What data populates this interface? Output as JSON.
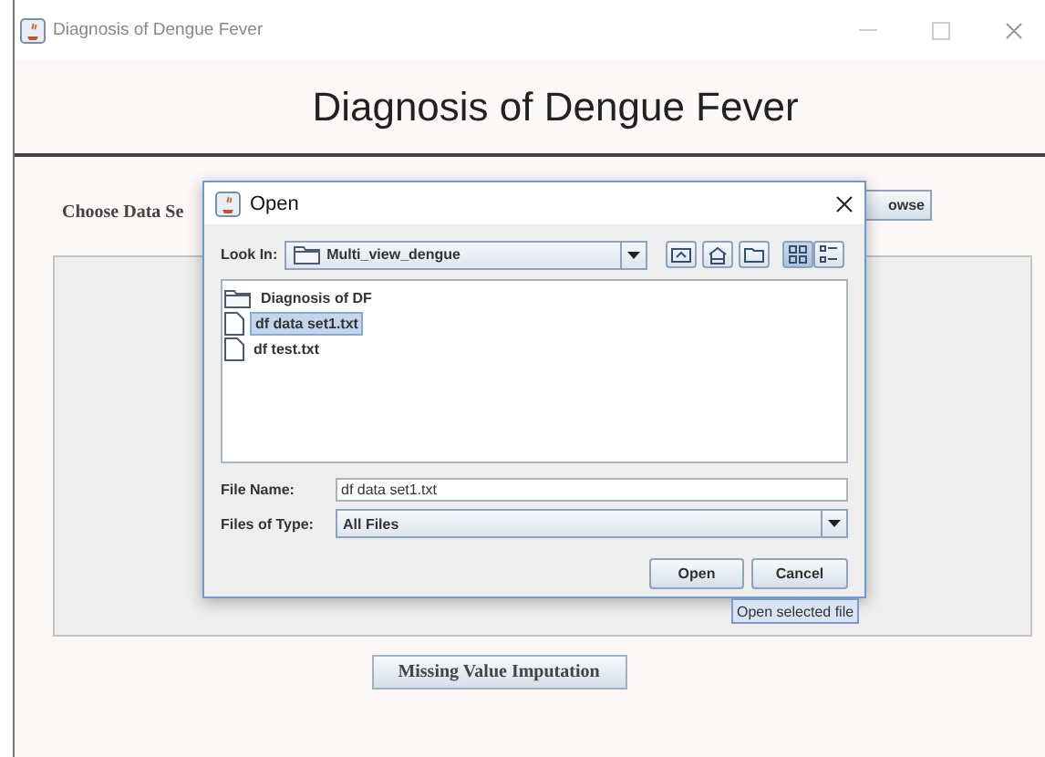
{
  "window": {
    "title": "Diagnosis of Dengue Fever"
  },
  "header": {
    "title": "Diagnosis of Dengue Fever"
  },
  "data_set": {
    "label": "Choose Data Se",
    "browse_button": "owse"
  },
  "imputation_button": "Missing Value Imputation",
  "dialog": {
    "title": "Open",
    "look_in": {
      "label": "Look In:",
      "value": "Multi_view_dengue"
    },
    "view_buttons": [
      {
        "kind": "list",
        "selected": true
      },
      {
        "kind": "details",
        "selected": false
      }
    ],
    "files": [
      {
        "name": "Diagnosis of DF",
        "kind": "folder",
        "selected": false
      },
      {
        "name": "df data set1.txt",
        "kind": "file",
        "selected": true
      },
      {
        "name": "df test.txt",
        "kind": "file",
        "selected": false
      }
    ],
    "file_name": {
      "label": "File Name:",
      "value": "df data set1.txt"
    },
    "file_type": {
      "label": "Files of Type:",
      "value": "All Files"
    },
    "buttons": [
      "Open",
      "Cancel"
    ],
    "tooltip": "Open selected file"
  }
}
